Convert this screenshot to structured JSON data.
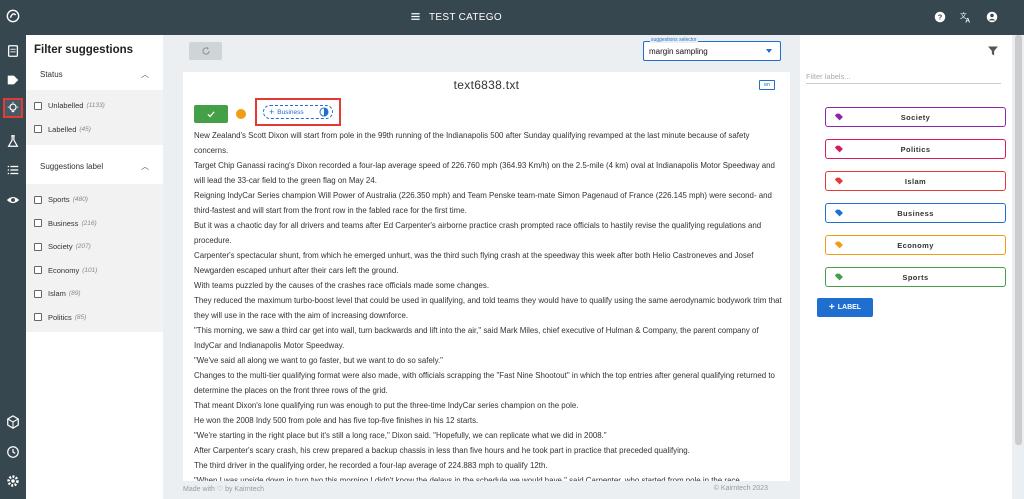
{
  "topbar": {
    "title": "TEST CATEGO",
    "help_icon": "help-circle-icon",
    "translate_icon": "translate-icon",
    "account_icon": "account-circle-icon"
  },
  "rail": {
    "items": [
      "logo-icon",
      "documents-icon",
      "labels-icon",
      "suggestions-icon",
      "lab-icon",
      "list-icon",
      "eye-icon",
      "box-icon",
      "history-icon",
      "settings-icon"
    ]
  },
  "filters": {
    "title": "Filter suggestions",
    "status": {
      "heading": "Status",
      "items": [
        {
          "label": "Unlabelled",
          "count": "(1133)"
        },
        {
          "label": "Labelled",
          "count": "(45)"
        }
      ]
    },
    "suggestions": {
      "heading": "Suggestions label",
      "items": [
        {
          "label": "Sports",
          "count": "(480)"
        },
        {
          "label": "Business",
          "count": "(216)"
        },
        {
          "label": "Society",
          "count": "(207)"
        },
        {
          "label": "Economy",
          "count": "(101)"
        },
        {
          "label": "Islam",
          "count": "(89)"
        },
        {
          "label": "Politics",
          "count": "(85)"
        }
      ]
    }
  },
  "selector": {
    "label": "suggestions selector",
    "value": "margin sampling"
  },
  "document": {
    "filename": "text6838.txt",
    "lang": "en",
    "suggestion_chip": "Business",
    "paragraphs": [
      "New Zealand's Scott Dixon will start from pole in the 99th running of the Indianapolis 500 after Sunday qualifying revamped at the last minute because of safety concerns.",
      "Target Chip Ganassi racing's Dixon recorded a four-lap average speed of 226.760 mph (364.93 Km/h) on the 2.5-mile (4 km) oval at Indianapolis Motor Speedway and will lead the 33-car field to the green flag on May 24.",
      "Reigning IndyCar Series champion Will Power of Australia (226.350 mph) and Team Penske team-mate Simon Pagenaud of France (226.145 mph) were second- and third-fastest and will start from the front row in the fabled race for the first time.",
      "But it was a chaotic day for all drivers and teams after Ed Carpenter's airborne practice crash prompted race officials to hastily revise the qualifying regulations and procedure.",
      "Carpenter's spectacular shunt, from which he emerged unhurt, was the third such flying crash at the speedway this week after both Helio Castroneves and Josef Newgarden escaped unhurt after their cars left the ground.",
      "With teams puzzled by the causes of the crashes race officials made some changes.",
      "They reduced the maximum turbo-boost level that could be used in qualifying, and told teams they would have to qualify using the same aerodynamic bodywork trim that they will use in the race with the aim of increasing downforce.",
      "\"This morning, we saw a third car get into wall, turn backwards and lift into the air,\" said Mark Miles, chief executive of Hulman & Company, the parent company of IndyCar and Indianapolis Motor Speedway.",
      "\"We've said all along we want to go faster, but we want to do so safely.\"",
      "Changes to the multi-tier qualifying format were also made, with officials scrapping the \"Fast Nine Shootout\" in which the top entries after general qualifying returned to determine the places on the front three rows of the grid.",
      "That meant Dixon's lone qualifying run was enough to put the three-time IndyCar series champion on the pole.",
      "He won the 2008 Indy 500 from pole and has five top-five finishes in his 12 starts.",
      "\"We're starting in the right place but it's still a long race,\" Dixon said. \"Hopefully, we can replicate what we did in 2008.\"",
      "After Carpenter's scary crash, his crew prepared a backup chassis in less than five hours and he took part in practice that preceded qualifying.",
      "The third driver in the qualifying order, he recorded a four-lap average of 224.883 mph to qualify 12th.",
      "\"When I was upside down in turn two this morning I didn't know the delays in the schedule we would have,\" said Carpenter, who started from pole in the race"
    ]
  },
  "footer": {
    "left": "Made with ♡ by Kairntech",
    "right": "©   Kairntech 2023"
  },
  "labels_panel": {
    "search_placeholder": "Filter labels...",
    "labels": [
      {
        "name": "Society",
        "color": "#8e24aa"
      },
      {
        "name": "Politics",
        "color": "#d81b60"
      },
      {
        "name": "Islam",
        "color": "#e53935"
      },
      {
        "name": "Business",
        "color": "#1e6fcf"
      },
      {
        "name": "Economy",
        "color": "#f39c12"
      },
      {
        "name": "Sports",
        "color": "#43a047"
      }
    ],
    "add_button": "LABEL"
  }
}
